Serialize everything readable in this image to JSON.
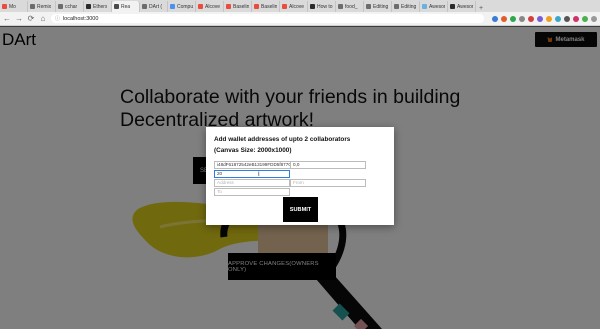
{
  "browser": {
    "tabs": [
      {
        "label": "Mo",
        "color": "#e84d3d"
      },
      {
        "label": "Remix",
        "color": "#6c6c6c"
      },
      {
        "label": "cchar",
        "color": "#6c6c6c"
      },
      {
        "label": "Ethers",
        "color": "#2a2a2a"
      },
      {
        "label": "Rea",
        "color": "#4a4a4a",
        "active": true
      },
      {
        "label": "DArt (",
        "color": "#6c6c6c"
      },
      {
        "label": "Compu",
        "color": "#4d8ff0"
      },
      {
        "label": "Alcove",
        "color": "#e84d3d"
      },
      {
        "label": "Baseline",
        "color": "#e84d3d"
      },
      {
        "label": "Baseline",
        "color": "#e84d3d"
      },
      {
        "label": "Alcove",
        "color": "#e84d3d"
      },
      {
        "label": "How to",
        "color": "#2a2a2a"
      },
      {
        "label": "food_",
        "color": "#6c6c6c"
      },
      {
        "label": "Editing",
        "color": "#6c6c6c"
      },
      {
        "label": "Editing",
        "color": "#6c6c6c"
      },
      {
        "label": "Aweson",
        "color": "#6ab0e0"
      },
      {
        "label": "Aweson",
        "color": "#2a2a2a"
      }
    ],
    "new_tab_symbol": "+",
    "url": "localhost:3000",
    "nav_icons": {
      "back": "←",
      "forward": "→",
      "reload": "⟳",
      "home": "⌂"
    },
    "extension_colors": [
      "#3a7bd5",
      "#e05c2a",
      "#2ca84e",
      "#888888",
      "#d23f3f",
      "#7a5cd6",
      "#f0a020",
      "#3aa6c9",
      "#555555",
      "#cc3366",
      "#4caf50",
      "#999999"
    ]
  },
  "page": {
    "logo": "DArt",
    "metamask_label": "Metamask",
    "headline_line1": "Collaborate with your friends in building",
    "headline_line2": "Decentralized artwork!",
    "select_button_fragment": "SE",
    "approve_label": "APPROVE CHANGES(OWNERS ONLY)"
  },
  "modal": {
    "title_line1": "Add wallet addresses of upto 2 collaborators",
    "title_line2": "(Canvas Size: 2000x1000)",
    "row1_address": "i48dF61872542eB13199FDD5f877O",
    "row1_from": "0,0",
    "row2_value": "20",
    "row3_address_placeholder": "Address",
    "row3_from_placeholder": "From",
    "row4_to_placeholder": "To",
    "cursor_glyph": "I",
    "submit_label": "SUBMIT"
  }
}
